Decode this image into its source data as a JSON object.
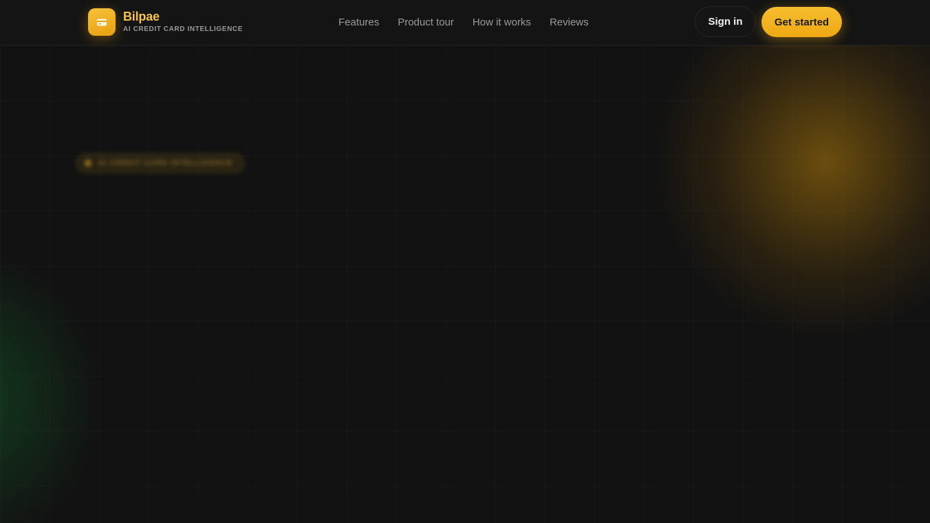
{
  "brand": {
    "name": "Bilpae",
    "tagline": "AI CREDIT CARD INTELLIGENCE",
    "logo_icon": "credit-card-icon",
    "accent": "#f5b82a"
  },
  "nav": {
    "items": [
      {
        "label": "Features"
      },
      {
        "label": "Product tour"
      },
      {
        "label": "How it works"
      },
      {
        "label": "Reviews"
      }
    ]
  },
  "actions": {
    "sign_in": "Sign in",
    "get_started": "Get started"
  },
  "hero": {
    "badge_text": "AI CREDIT CARD INTELLIGENCE"
  }
}
